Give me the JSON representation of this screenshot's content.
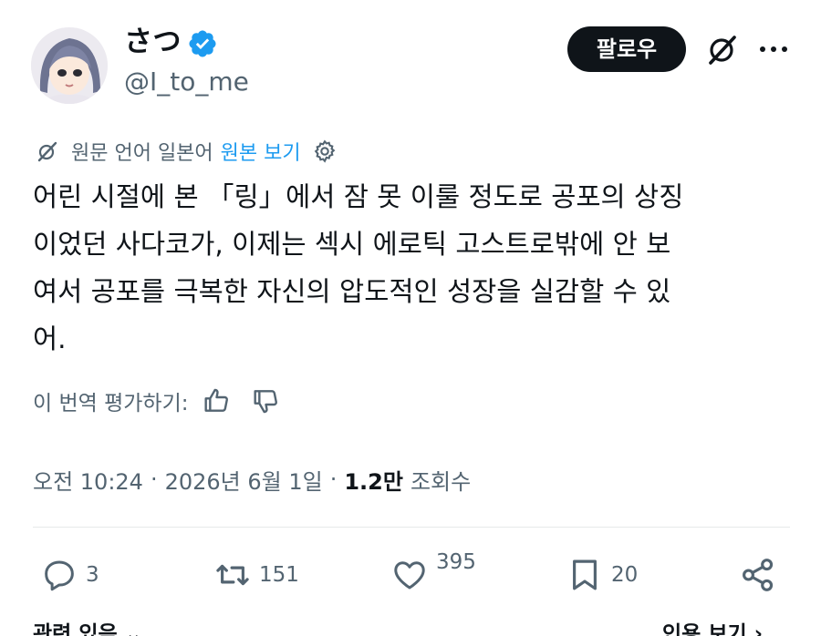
{
  "user": {
    "display_name": "さつ",
    "handle": "@I_to_me",
    "verified": true
  },
  "header": {
    "follow_label": "팔로우"
  },
  "translation": {
    "source_label": "원문 언어 일본어",
    "show_original_label": "원본 보기"
  },
  "tweet": {
    "lines": [
      "어린 시절에 본 「링」에서 잠 못 이룰 정도로 공포의 상징",
      "이었던 사다코가, 이제는 섹시 에로틱 고스트로밖에 안 보",
      "여서 공포를 극복한 자신의 압도적인 성장을 실감할 수 있",
      "어."
    ]
  },
  "rating": {
    "label": "이 번역 평가하기:"
  },
  "meta": {
    "time": "오전 10:24",
    "separator": "·",
    "date": "2026년 6월 1일",
    "views_count": "1.2만",
    "views_label": "조회수"
  },
  "actions": {
    "reply_count": "3",
    "retweet_count": "151",
    "like_count": "395",
    "bookmark_count": "20"
  },
  "footer": {
    "left_label": "관련 있음",
    "right_label": "인용 보기"
  },
  "colors": {
    "accent": "#1d9bf0",
    "text_primary": "#0f1419",
    "text_secondary": "#536471",
    "button_dark": "#0f1419"
  },
  "icons": {
    "verified": "verified-badge-icon",
    "grok": "grok-icon",
    "more": "more-icon",
    "settings": "gear-icon",
    "thumb_up": "thumb-up-icon",
    "thumb_down": "thumb-down-icon",
    "reply": "reply-icon",
    "retweet": "retweet-icon",
    "like": "heart-icon",
    "bookmark": "bookmark-icon",
    "share": "share-icon",
    "chevron": "chevron-down-icon"
  }
}
